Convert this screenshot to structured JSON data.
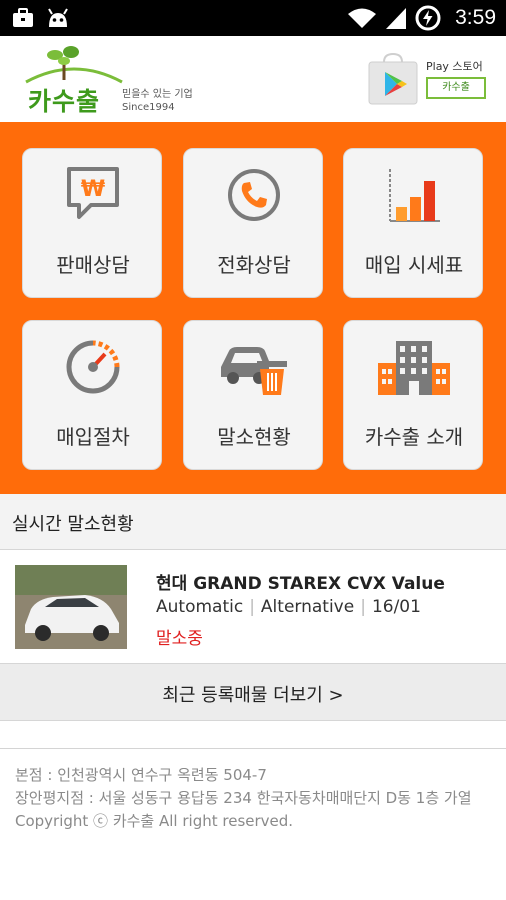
{
  "status_bar": {
    "time": "3:59",
    "left_icons": [
      "briefcase-icon",
      "android-icon"
    ],
    "right_icons": [
      "wifi-icon",
      "signal-icon",
      "battery-charging-icon"
    ]
  },
  "header": {
    "logo_name": "카수출",
    "logo_tagline_1": "믿을수 있는 기업",
    "logo_tagline_2": "Since1994",
    "store_label": "Play 스토어",
    "store_button": "카수출"
  },
  "menu": {
    "background": "#ff6c0a",
    "tiles": [
      {
        "label": "판매상담",
        "icon": "won-speech-bubble-icon"
      },
      {
        "label": "전화상담",
        "icon": "phone-icon"
      },
      {
        "label": "매입 시세표",
        "icon": "bar-chart-icon"
      },
      {
        "label": "매입절차",
        "icon": "gauge-icon"
      },
      {
        "label": "말소현황",
        "icon": "car-trash-icon"
      },
      {
        "label": "카수출 소개",
        "icon": "building-icon"
      }
    ]
  },
  "live": {
    "heading": "실시간 말소현황",
    "car": {
      "title": "현대 GRAND STAREX CVX Value",
      "transmission": "Automatic",
      "fuel": "Alternative",
      "date": "16/01",
      "status": "말소중",
      "status_color": "#e02020"
    }
  },
  "more_button": "최근 등록매물 더보기 >",
  "footer": {
    "line1": "본점 : 인천광역시 연수구 옥련동 504-7",
    "line2": "장안평지점 : 서울 성동구 용답동 234 한국자동차매매단지 D동 1층 가열",
    "copyright": "Copyright ⓒ 카수출 All right reserved."
  }
}
